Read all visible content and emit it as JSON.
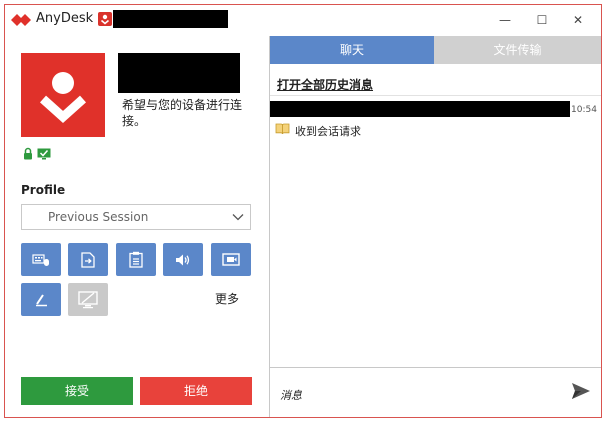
{
  "titlebar": {
    "app_name": "AnyDesk",
    "min_glyph": "—",
    "max_glyph": "☐",
    "close_glyph": "✕"
  },
  "request": {
    "message": "希望与您的设备进行连接。"
  },
  "profile": {
    "label": "Profile",
    "selected": "Previous Session"
  },
  "permissions": {
    "more_label": "更多"
  },
  "actions": {
    "accept": "接受",
    "reject": "拒绝"
  },
  "tabs": {
    "chat": "聊天",
    "files": "文件传输"
  },
  "chat": {
    "history_link": "打开全部历史消息",
    "message_time": "10:54",
    "session_request": "收到会话请求",
    "compose_placeholder": "消息"
  },
  "colors": {
    "brand_red": "#e0312a",
    "accent_blue": "#5b87c9",
    "accept_green": "#2e9a3e",
    "reject_red": "#e8423b",
    "disabled_gray": "#c9c9c9"
  }
}
